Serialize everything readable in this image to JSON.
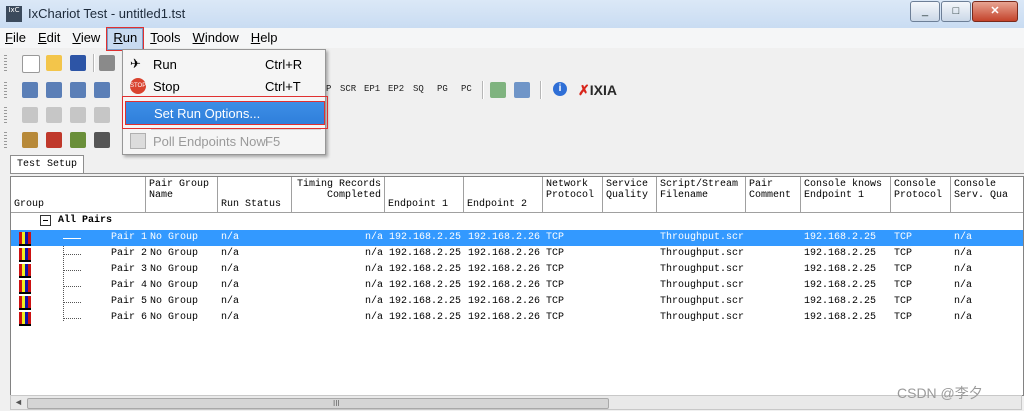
{
  "window": {
    "title": "IxChariot Test - untitled1.tst",
    "icon_text": "IxC",
    "controls": [
      "_",
      "□",
      "✕"
    ]
  },
  "menubar": {
    "items": [
      {
        "label": "File",
        "key": "F",
        "rest": "ile"
      },
      {
        "label": "Edit",
        "key": "E",
        "rest": "dit"
      },
      {
        "label": "View",
        "key": "V",
        "rest": "iew"
      },
      {
        "label": "Run",
        "key": "R",
        "rest": "un"
      },
      {
        "label": "Tools",
        "key": "T",
        "rest": "ools"
      },
      {
        "label": "Window",
        "key": "W",
        "rest": "indow"
      },
      {
        "label": "Help",
        "key": "H",
        "rest": "elp"
      }
    ]
  },
  "run_menu": {
    "items": [
      {
        "label": "Run",
        "shortcut": "Ctrl+R",
        "icon": "runner-icon",
        "state": "normal"
      },
      {
        "label": "Stop",
        "shortcut": "Ctrl+T",
        "icon": "stop-icon",
        "state": "normal"
      },
      {
        "label": "Set Run Options...",
        "shortcut": "",
        "icon": "",
        "state": "highlighted"
      },
      {
        "label": "Poll Endpoints Now",
        "shortcut": "F5",
        "icon": "poll-icon",
        "state": "disabled"
      }
    ]
  },
  "toolbar": {
    "protocol_buttons": [
      "P",
      "SCR",
      "EP1",
      "EP2",
      "SQ",
      "PG",
      "PC"
    ],
    "brand": "IXIA"
  },
  "tabs": [
    "Test Setup"
  ],
  "grid": {
    "columns": [
      "Group",
      "Pair Group\nName",
      "Run Status",
      "Timing Records\nCompleted",
      "Endpoint 1",
      "Endpoint 2",
      "Network\nProtocol",
      "Service\nQuality",
      "Script/Stream\nFilename",
      "Pair\nComment",
      "Console knows\nEndpoint 1",
      "Console\nProtocol",
      "Console\nServ. Qua"
    ],
    "group_label": "All Pairs",
    "rows": [
      {
        "pair": "Pair 1",
        "group_name": "No Group",
        "run_status": "n/a",
        "timing": "n/a",
        "ep1": "192.168.2.25",
        "ep2": "192.168.2.26",
        "protocol": "TCP",
        "quality": "",
        "script": "Throughput.scr",
        "comment": "",
        "console_ep1": "192.168.2.25",
        "console_protocol": "TCP",
        "console_qual": "n/a"
      },
      {
        "pair": "Pair 2",
        "group_name": "No Group",
        "run_status": "n/a",
        "timing": "n/a",
        "ep1": "192.168.2.25",
        "ep2": "192.168.2.26",
        "protocol": "TCP",
        "quality": "",
        "script": "Throughput.scr",
        "comment": "",
        "console_ep1": "192.168.2.25",
        "console_protocol": "TCP",
        "console_qual": "n/a"
      },
      {
        "pair": "Pair 3",
        "group_name": "No Group",
        "run_status": "n/a",
        "timing": "n/a",
        "ep1": "192.168.2.25",
        "ep2": "192.168.2.26",
        "protocol": "TCP",
        "quality": "",
        "script": "Throughput.scr",
        "comment": "",
        "console_ep1": "192.168.2.25",
        "console_protocol": "TCP",
        "console_qual": "n/a"
      },
      {
        "pair": "Pair 4",
        "group_name": "No Group",
        "run_status": "n/a",
        "timing": "n/a",
        "ep1": "192.168.2.25",
        "ep2": "192.168.2.26",
        "protocol": "TCP",
        "quality": "",
        "script": "Throughput.scr",
        "comment": "",
        "console_ep1": "192.168.2.25",
        "console_protocol": "TCP",
        "console_qual": "n/a"
      },
      {
        "pair": "Pair 5",
        "group_name": "No Group",
        "run_status": "n/a",
        "timing": "n/a",
        "ep1": "192.168.2.25",
        "ep2": "192.168.2.26",
        "protocol": "TCP",
        "quality": "",
        "script": "Throughput.scr",
        "comment": "",
        "console_ep1": "192.168.2.25",
        "console_protocol": "TCP",
        "console_qual": "n/a"
      },
      {
        "pair": "Pair 6",
        "group_name": "No Group",
        "run_status": "n/a",
        "timing": "n/a",
        "ep1": "192.168.2.25",
        "ep2": "192.168.2.26",
        "protocol": "TCP",
        "quality": "",
        "script": "Throughput.scr",
        "comment": "",
        "console_ep1": "192.168.2.25",
        "console_protocol": "TCP",
        "console_qual": "n/a"
      }
    ],
    "selected_row": 0
  },
  "scrollbar": {
    "grip": "III",
    "left_arrow": "◄"
  },
  "watermark": "CSDN @李夕",
  "colors": {
    "selection": "#3399ff",
    "highlight": "#2f7fdb",
    "annotation": "#e03030"
  }
}
